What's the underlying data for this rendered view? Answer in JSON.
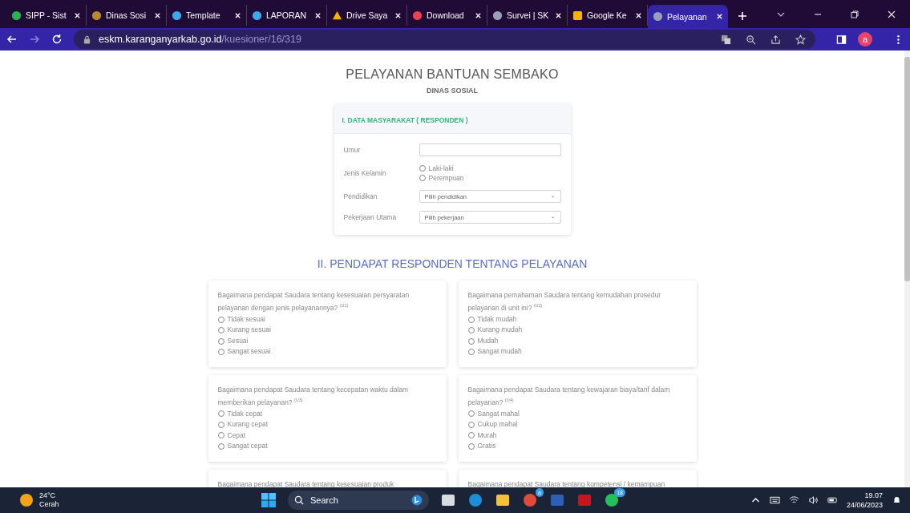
{
  "browser": {
    "tabs": [
      {
        "title": "SIPP - Sist",
        "kind": "sipp",
        "selected": false
      },
      {
        "title": "Dinas Sosi",
        "kind": "crest",
        "selected": false
      },
      {
        "title": "Template",
        "kind": "canva",
        "selected": false
      },
      {
        "title": "LAPORAN",
        "kind": "canva",
        "selected": false
      },
      {
        "title": "Drive Saya",
        "kind": "drive",
        "selected": false
      },
      {
        "title": "Download",
        "kind": "heart",
        "selected": false
      },
      {
        "title": "Survei | SK",
        "kind": "globe",
        "selected": false
      },
      {
        "title": "Google Ke",
        "kind": "keep",
        "selected": false
      },
      {
        "title": "Pelayanan",
        "kind": "globe",
        "selected": true
      }
    ],
    "address": {
      "host": "eskm.karanganyarkab.go.id",
      "path": "/kuesioner/16/319"
    },
    "profile": "a"
  },
  "page": {
    "title": "PELAYANAN BANTUAN SEMBAKO",
    "subtitle": "DINAS SOSIAL",
    "section1": {
      "heading": "I. DATA MASYARAKAT ( RESPONDEN )",
      "fields": [
        {
          "kind": "text",
          "label": "Umur"
        },
        {
          "kind": "radio",
          "label": "Jenis Kelamin",
          "options": [
            {
              "label": "Laki-laki",
              "selected": false
            },
            {
              "label": "Perempuan",
              "selected": false
            }
          ]
        },
        {
          "kind": "select",
          "label": "Pendidikan",
          "value": "Pilih pendidikan"
        },
        {
          "kind": "select",
          "label": "Pekerjaan Utama",
          "value": "Pilih pekerjaan"
        }
      ]
    },
    "section2": {
      "heading": "II. PENDAPAT RESPONDEN TENTANG PELAYANAN",
      "questions": [
        {
          "text": "Bagaimana pendapat Saudara tentang kesesuaian persyaratan pelayanan dengan jenis pelayanannya? $^{(U1)}$",
          "options": [
            {
              "label": "Tidak sesuai",
              "selected": false
            },
            {
              "label": "Kurang sesuai",
              "selected": false
            },
            {
              "label": "Sesuai",
              "selected": false
            },
            {
              "label": "Sangat sesuai",
              "selected": false
            }
          ]
        },
        {
          "text": "Bagaimana pemahaman Saudara tentang kemudahan prosedur pelayanan di unit ini? $^{(U2)}$",
          "options": [
            {
              "label": "Tidak mudah",
              "selected": false
            },
            {
              "label": "Kurang mudah",
              "selected": false
            },
            {
              "label": "Mudah",
              "selected": false
            },
            {
              "label": "Sangat mudah",
              "selected": false
            }
          ]
        },
        {
          "text": "Bagaimana pendapat Saudara tentang kecepatan waktu dalam memberikan pelayanan? $^{(U3)}$",
          "options": [
            {
              "label": "Tidak cepat",
              "selected": false
            },
            {
              "label": "Kurang cepat",
              "selected": false
            },
            {
              "label": "Cepat",
              "selected": false
            },
            {
              "label": "Sangat cepat",
              "selected": false
            }
          ]
        },
        {
          "text": "Bagaimana pendapat Saudara tentang kewajaran biaya/tarif dalam pelayanan? $^{(U4)}$",
          "options": [
            {
              "label": "Sangat mahal",
              "selected": false
            },
            {
              "label": "Cukup mahal",
              "selected": false
            },
            {
              "label": "Murah",
              "selected": false
            },
            {
              "label": "Gratis",
              "selected": false
            }
          ]
        },
        {
          "text": "Bagaimana pendapat Saudara tentang kesesuaian produk"
        },
        {
          "text": "Bagaimana pendapat Saudara tentang kompetensi / kemampuan"
        }
      ]
    }
  },
  "taskbar": {
    "temperature": "24°C",
    "weather": "Cerah",
    "search": "Search",
    "apps": [
      {
        "kind": "taskview"
      },
      {
        "kind": "edge"
      },
      {
        "kind": "folder"
      },
      {
        "kind": "chrome",
        "badge": "a"
      },
      {
        "kind": "word"
      },
      {
        "kind": "pdf"
      },
      {
        "kind": "whatsapp",
        "badge": "18"
      }
    ],
    "time": "19.07",
    "date": "24/06/2023"
  }
}
